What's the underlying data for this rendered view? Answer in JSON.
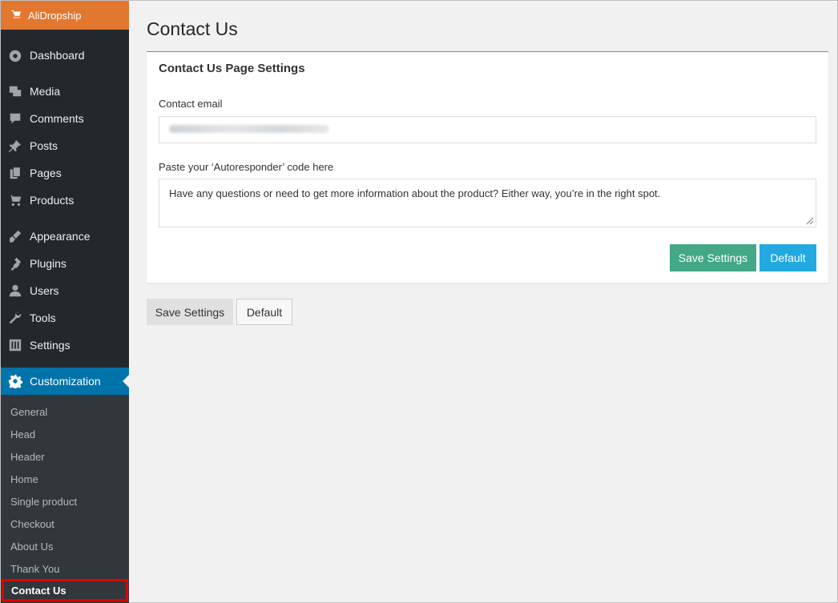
{
  "sidebar": {
    "brand": "AliDropship",
    "items": [
      {
        "label": "Dashboard",
        "icon": "dashboard-icon"
      },
      {
        "label": "Media",
        "icon": "media-icon"
      },
      {
        "label": "Comments",
        "icon": "comments-icon"
      },
      {
        "label": "Posts",
        "icon": "pin-icon"
      },
      {
        "label": "Pages",
        "icon": "pages-icon"
      },
      {
        "label": "Products",
        "icon": "cart-icon"
      },
      {
        "label": "Appearance",
        "icon": "brush-icon"
      },
      {
        "label": "Plugins",
        "icon": "plug-icon"
      },
      {
        "label": "Users",
        "icon": "user-icon"
      },
      {
        "label": "Tools",
        "icon": "wrench-icon"
      },
      {
        "label": "Settings",
        "icon": "settings-icon"
      },
      {
        "label": "Customization",
        "icon": "gear-icon"
      }
    ],
    "submenu": [
      "General",
      "Head",
      "Header",
      "Home",
      "Single product",
      "Checkout",
      "About Us",
      "Thank You",
      "Contact Us"
    ]
  },
  "main": {
    "title": "Contact Us",
    "panel": {
      "title": "Contact Us Page Settings",
      "email_label": "Contact email",
      "email_value": "",
      "autoresponder_label": "Paste your ‘Autoresponder’ code here",
      "autoresponder_value": "Have any questions or need to get more information about the product? Either way, you’re in the right spot.",
      "save_label": "Save Settings",
      "default_label": "Default"
    },
    "bottom_save_label": "Save Settings",
    "bottom_default_label": "Default"
  },
  "colors": {
    "brand": "#e27730",
    "active": "#0073aa",
    "save_green": "#43a887",
    "default_blue": "#22a9e1",
    "highlight_red": "#e00000"
  }
}
